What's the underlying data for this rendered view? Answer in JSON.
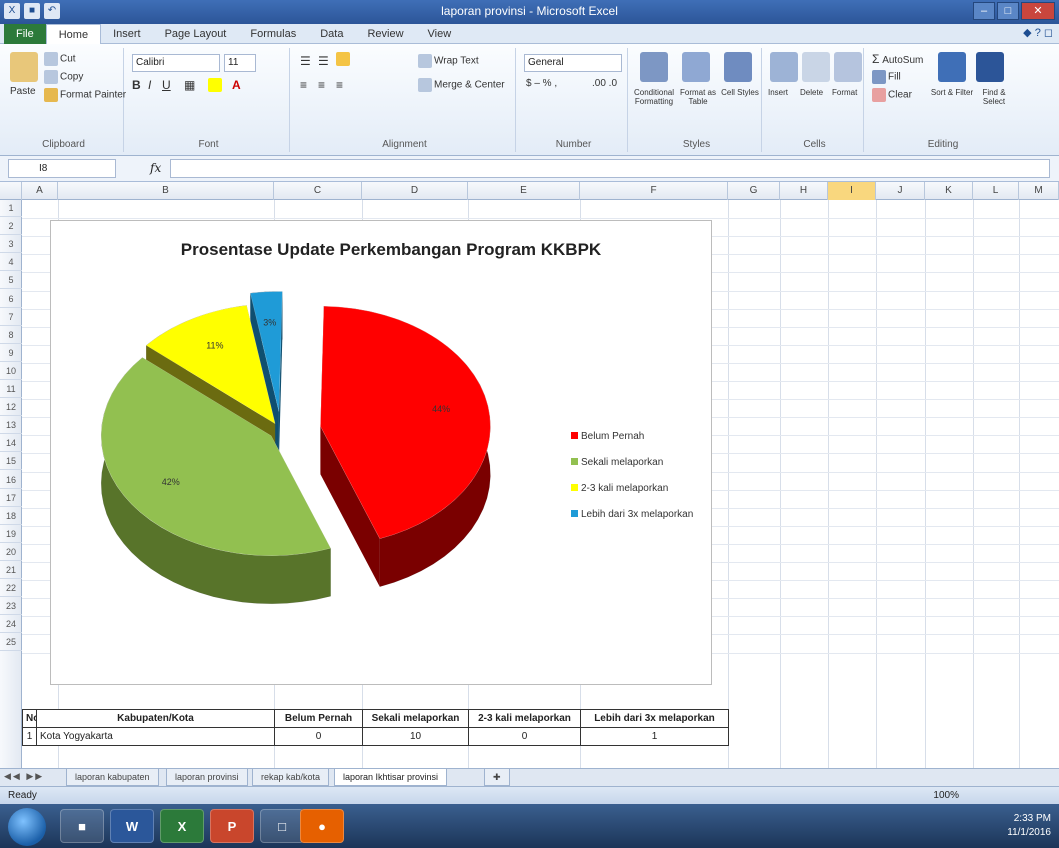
{
  "window": {
    "title": "laporan provinsi - Microsoft Excel"
  },
  "ribbon": {
    "tabs": [
      "File",
      "Home",
      "Insert",
      "Page Layout",
      "Formulas",
      "Data",
      "Review",
      "View"
    ],
    "clipboard": {
      "paste": "Paste",
      "cut": "Cut",
      "copy": "Copy",
      "format_painter": "Format Painter",
      "label": "Clipboard"
    },
    "font": {
      "name": "Calibri",
      "size": "11",
      "label": "Font"
    },
    "alignment": {
      "wrap_text": "Wrap Text",
      "merge": "Merge & Center",
      "label": "Alignment"
    },
    "number": {
      "format": "General",
      "label": "Number"
    },
    "styles": {
      "conditional": "Conditional Formatting",
      "format_table": "Format as Table",
      "cell_styles": "Cell Styles",
      "label": "Styles"
    },
    "cells": {
      "insert": "Insert",
      "delete": "Delete",
      "format": "Format",
      "label": "Cells"
    },
    "editing": {
      "autosum": "AutoSum",
      "fill": "Fill",
      "clear": "Clear",
      "sort": "Sort & Filter",
      "find": "Find & Select",
      "label": "Editing"
    }
  },
  "formula_bar": {
    "name_box": "I8",
    "fx": "fx",
    "value": ""
  },
  "columns": [
    "A",
    "B",
    "C",
    "D",
    "E",
    "F",
    "G",
    "H",
    "I",
    "J",
    "K",
    "L",
    "M"
  ],
  "selected_column": "I",
  "rows": [
    "1",
    "2",
    "3",
    "4",
    "5",
    "6",
    "7",
    "8",
    "9",
    "10",
    "11",
    "12",
    "13",
    "14",
    "15",
    "16",
    "17",
    "18",
    "19",
    "20",
    "21",
    "22",
    "23",
    "24",
    "25"
  ],
  "chart_data": {
    "type": "pie",
    "title": "Prosentase Update Perkembangan Program KKBPK",
    "categories": [
      "Belum Pernah",
      "Sekali melaporkan",
      "2-3 kali melaporkan",
      "Lebih dari 3x melaporkan"
    ],
    "values": [
      44,
      42,
      11,
      3
    ],
    "data_labels": [
      "44%",
      "42%",
      "11%",
      "3%"
    ],
    "colors": [
      "#ff0000",
      "#92c050",
      "#ffff00",
      "#1f9bd7"
    ],
    "side_colors": [
      "#7a0000",
      "#58742a",
      "#6b6b10",
      "#0f4f70"
    ],
    "legend_position": "right"
  },
  "table": {
    "headers": [
      "No",
      "Kabupaten/Kota",
      "Belum Pernah",
      "Sekali melaporkan",
      "2-3 kali melaporkan",
      "Lebih dari 3x melaporkan"
    ],
    "rows": [
      [
        "1",
        "Kota Yogyakarta",
        "0",
        "10",
        "0",
        "1"
      ]
    ]
  },
  "sheet_tabs": [
    "laporan kabupaten",
    "laporan provinsi",
    "rekap kab/kota",
    "laporan Ikhtisar provinsi"
  ],
  "active_sheet": 3,
  "status": {
    "ready": "Ready",
    "zoom": "100%"
  },
  "taskbar": {
    "word": "W",
    "excel": "X",
    "powerpoint": "P",
    "time": "2:33 PM",
    "date": "11/1/2016"
  }
}
